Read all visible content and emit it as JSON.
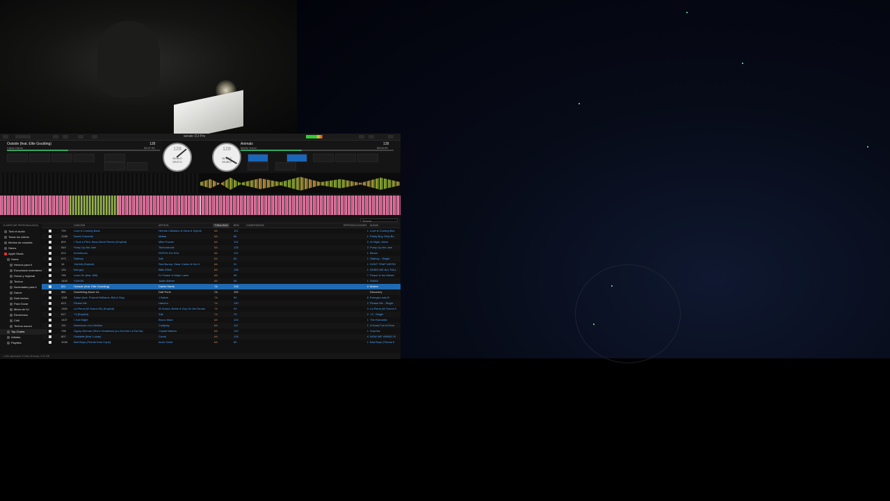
{
  "app": {
    "name": "serato",
    "edition": "DJ Pro"
  },
  "colors": {
    "accent": "#1f6bb3",
    "link": "#4aa3ff",
    "waveform": "#e06a9a"
  },
  "deck_left": {
    "title": "Outside (feat. Ellie Goulding)",
    "artist": "Calvin Harris",
    "bpm": "128",
    "time": "03:27.00",
    "platter_bpm": "128",
    "platter_time_a": "00:00.0",
    "platter_time_b": "03:27.0",
    "pads": [
      "",
      "",
      "",
      ""
    ]
  },
  "deck_right": {
    "title": "Animals",
    "artist": "Martin Garrix",
    "bpm": "128",
    "time": "05:04.00",
    "platter_bpm": "128",
    "platter_time_a": "00:57.0",
    "platter_time_b": "03:45.0",
    "pads": [
      "",
      "",
      "",
      ""
    ]
  },
  "library": {
    "search_placeholder": "Buscar",
    "headers": {
      "song": "CANCIÓN",
      "artist": "ARTISTA",
      "key": "TONALIDAD",
      "bpm": "BPM",
      "comment": "COMENTARIOS",
      "plays": "REPRODUCCIONES",
      "album": "ÁLBUM"
    },
    "sidebar_header": "CLASIFICAR PERSONALIZADA",
    "sidebar": [
      "Todo el audio",
      "Todos los vídeos",
      "Medios de consulta",
      "Stems",
      "Apple Music",
      "Home",
      "Hechos para ti",
      "Escuchado recientemente",
      "House y regional",
      "Techno",
      "Novedades para ti",
      "Dance",
      "Dubi techno",
      "Para Gozar",
      "Mixes de DJ",
      "Electrónica",
      "Chill",
      "Techno oscuro",
      "Top Charts",
      "Artistas",
      "Playlists"
    ],
    "rows": [
      {
        "n": "799",
        "song": "Love is Coming Back",
        "artist": "Hernán Cattáneo & Hans & Zeyrek",
        "key": "5A",
        "bpm": "121",
        "plays": "1",
        "album": "Love is Coming Bac"
      },
      {
        "n": "1288",
        "song": "Dumb Concrete",
        "artist": "Malaa",
        "key": "5A",
        "bpm": "86",
        "plays": "1",
        "album": "Pretty Boy, Dirty Bo"
      },
      {
        "n": "802",
        "song": "I Took a Pill in Ibiza (Seeb Remix) (Explicit)",
        "artist": "Mike Posner",
        "key": "5A",
        "bpm": "102",
        "plays": "5",
        "album": "At Night, Alone"
      },
      {
        "n": "649",
        "song": "Pump Up the Jam",
        "artist": "Technotronic",
        "key": "5A",
        "bpm": "125",
        "plays": "3",
        "album": "Pump Up the Jam"
      },
      {
        "n": "874",
        "song": "Innerbloom",
        "artist": "RÜFÜS DU SOL",
        "key": "5A",
        "bpm": "122",
        "plays": "1",
        "album": "Bloom"
      },
      {
        "n": "873",
        "song": "Starboy",
        "artist": "Zali",
        "key": "5A",
        "bpm": "80",
        "plays": "1",
        "album": "Starboy - Single"
      },
      {
        "n": "16",
        "song": "YALWA (Explicit)",
        "artist": "Red Bunny, Omar Cortez & Dol V",
        "key": "8A",
        "bpm": "91",
        "plays": "1",
        "album": "DONT TRAP WE'RO"
      },
      {
        "n": "134",
        "song": "bad guy",
        "artist": "Billie Eilish",
        "key": "8A",
        "bpm": "135",
        "plays": "1",
        "album": "WHEN WE ALL FALL"
      },
      {
        "n": "755",
        "song": "Lean On (feat. MØ)",
        "artist": "DJ Snake & Major Lazer",
        "key": "8A",
        "bpm": "98",
        "plays": "7",
        "album": "Peace Is the Missio"
      },
      {
        "n": "1400",
        "song": "YUKON",
        "artist": "Justin Bieber",
        "key": "8A",
        "bpm": "96",
        "plays": "1",
        "album": "SWAG"
      },
      {
        "n": "811",
        "song": "Outside (feat. Ellie Goulding)",
        "artist": "Calvin Harris",
        "key": "7A",
        "bpm": "128",
        "plays": "4",
        "album": "Motion",
        "selected": true
      },
      {
        "n": "961",
        "song": "Something About Us",
        "artist": "Daft Punk",
        "key": "7A",
        "bpm": "100",
        "plays": "",
        "album": "Discovery",
        "played": true
      },
      {
        "n": "1281",
        "song": "Safari (feat. Pharrell Williams, BIA & Sky)",
        "artist": "J Balvin",
        "key": "7A",
        "bpm": "90",
        "plays": "8",
        "album": "Energía Lado B"
      },
      {
        "n": "813",
        "song": "Please Me",
        "artist": "Hancho",
        "key": "7A",
        "bpm": "130",
        "plays": "2",
        "album": "Please Me - Single"
      },
      {
        "n": "1300",
        "song": "La Plena (W Sound 05) (Explicit)",
        "artist": "W Sound, Beéle & Ovy On the Drums",
        "key": "7A",
        "bpm": "93",
        "plays": "3",
        "album": "La Plena (W Sound 0"
      },
      {
        "n": "817",
        "song": "+3 (Explicit)",
        "artist": "Zali",
        "key": "7A",
        "bpm": "75",
        "plays": "2",
        "album": "+3 - Single"
      },
      {
        "n": "1437",
        "song": "I Just Might",
        "artist": "Bruno Mars",
        "key": "6A",
        "bpm": "103",
        "plays": "1",
        "album": "The Romantic"
      },
      {
        "n": "131",
        "song": "Adventure of a Lifetime",
        "artist": "Coldplay",
        "key": "6A",
        "bpm": "112",
        "plays": "1",
        "album": "A Head Full of Drea"
      },
      {
        "n": "798",
        "song": "Gypsy Woman (She's Homeless) (La Da Dee La Da Da)",
        "artist": "Crystal Waters",
        "key": "6A",
        "bpm": "120",
        "plays": "1",
        "album": "Surprise"
      },
      {
        "n": "807",
        "song": "Ovidable (feat. Lucas)",
        "artist": "Cordo",
        "key": "6A",
        "bpm": "126",
        "plays": "4",
        "album": "NOW WE VIBING SI"
      },
      {
        "n": "1038",
        "song": "Bad Boys (Theme from Cops)",
        "artist": "Inner Circle",
        "key": "6A",
        "bpm": "80",
        "plays": "1",
        "album": "Bad Boys (Theme fr"
      }
    ],
    "status": "1,430 canciones, 3 Días 15 horas, 2.91 GB"
  }
}
